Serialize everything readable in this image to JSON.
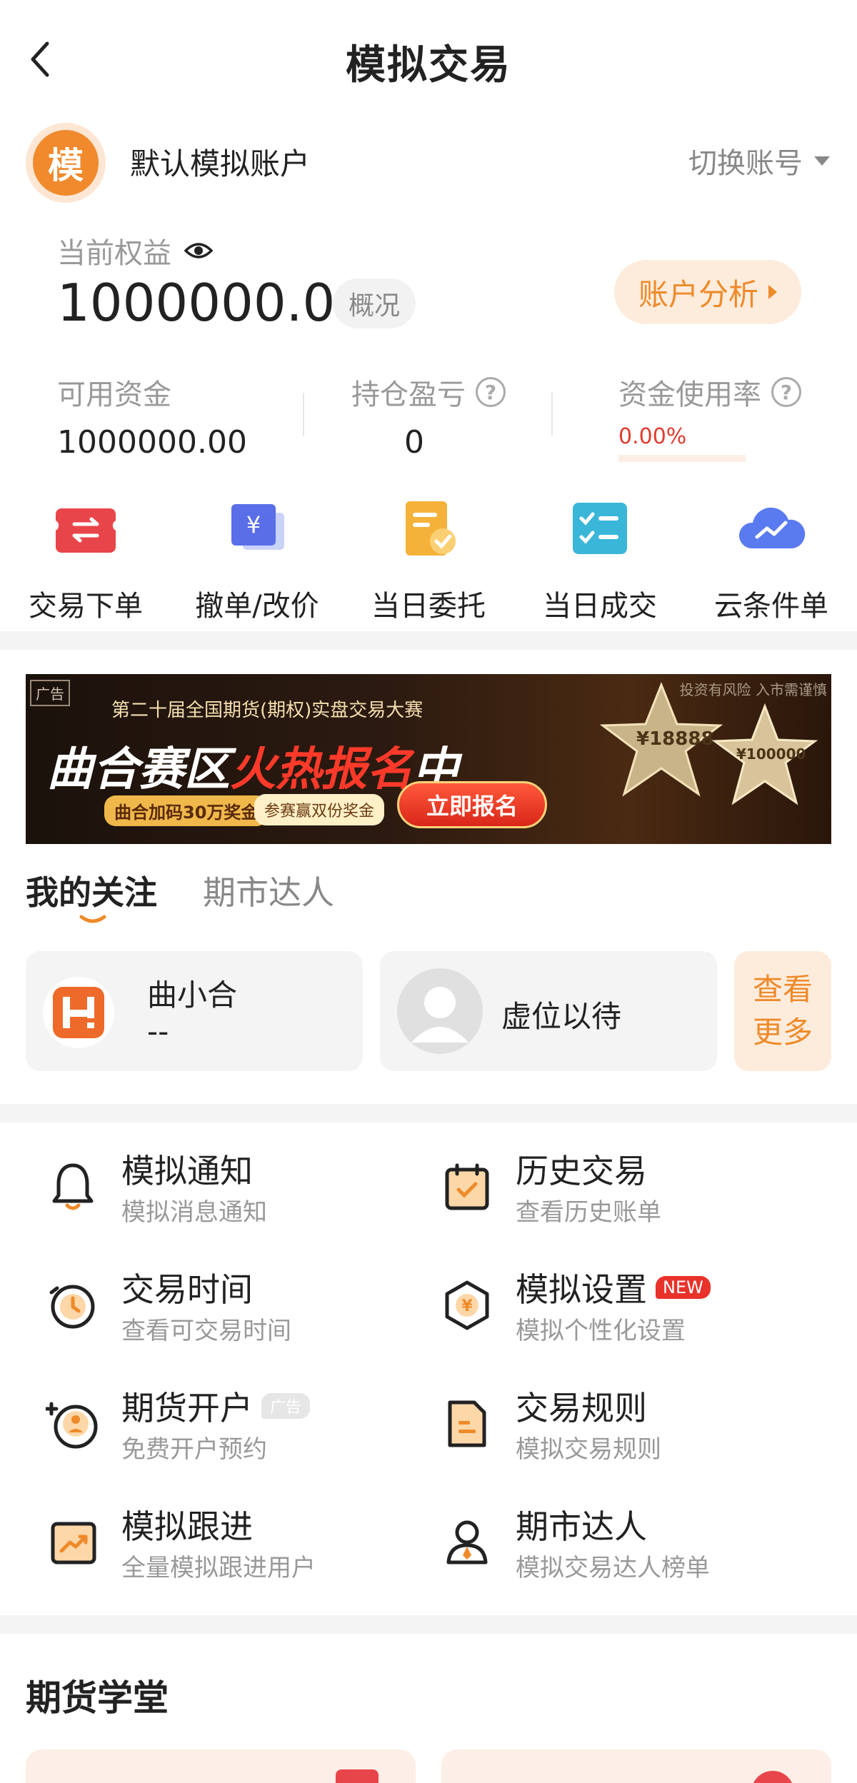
{
  "header": {
    "title": "模拟交易"
  },
  "account": {
    "avatar_char": "模",
    "name": "默认模拟账户",
    "switch_label": "切换账号"
  },
  "equity": {
    "label": "当前权益",
    "value": "1000000.00",
    "overview_label": "概况",
    "analysis_label": "账户分析"
  },
  "stats": {
    "available": {
      "label": "可用资金",
      "value": "1000000.00"
    },
    "pnl": {
      "label": "持仓盈亏",
      "value": "0"
    },
    "usage": {
      "label": "资金使用率",
      "value": "0.00%",
      "fill": 0
    }
  },
  "actions": [
    {
      "label": "交易下单",
      "icon": "exchange-icon"
    },
    {
      "label": "撤单/改价",
      "icon": "yen-card-icon"
    },
    {
      "label": "当日委托",
      "icon": "order-doc-icon"
    },
    {
      "label": "当日成交",
      "icon": "checklist-icon"
    },
    {
      "label": "云条件单",
      "icon": "cloud-chart-icon"
    }
  ],
  "banner": {
    "ad_tag": "广告",
    "risk_text": "投资有风险 入市需谨慎",
    "subtitle": "第二十届全国期货(期权)实盘交易大赛",
    "headline_a": "曲合赛区",
    "headline_b": "火热报名",
    "headline_c": "中",
    "pill_a": "曲合加码30万奖金",
    "pill_b": "参赛赢双份奖金",
    "cta": "立即报名",
    "prize_a": "¥18888",
    "prize_b": "¥100000"
  },
  "tabs": [
    {
      "label": "我的关注"
    },
    {
      "label": "期市达人"
    }
  ],
  "follow": {
    "card1_name": "曲小合",
    "card1_value": "--",
    "card2_name": "虚位以待",
    "more_line1": "查看",
    "more_line2": "更多"
  },
  "menu": [
    {
      "title": "模拟通知",
      "sub": "模拟消息通知",
      "icon": "bell-icon"
    },
    {
      "title": "历史交易",
      "sub": "查看历史账单",
      "icon": "calendar-check-icon"
    },
    {
      "title": "交易时间",
      "sub": "查看可交易时间",
      "icon": "clock-icon"
    },
    {
      "title": "模拟设置",
      "sub": "模拟个性化设置",
      "icon": "yen-hex-icon",
      "badge": "NEW"
    },
    {
      "title": "期货开户",
      "sub": "免费开户预约",
      "icon": "user-add-icon",
      "badge": "广告"
    },
    {
      "title": "交易规则",
      "sub": "模拟交易规则",
      "icon": "document-icon"
    },
    {
      "title": "模拟跟进",
      "sub": "全量模拟跟进用户",
      "icon": "trend-board-icon"
    },
    {
      "title": "期市达人",
      "sub": "模拟交易达人榜单",
      "icon": "expert-user-icon"
    }
  ],
  "school": {
    "title": "期货学堂"
  },
  "colors": {
    "accent": "#EE8A2A",
    "red": "#E8322A",
    "muted": "#999999"
  }
}
